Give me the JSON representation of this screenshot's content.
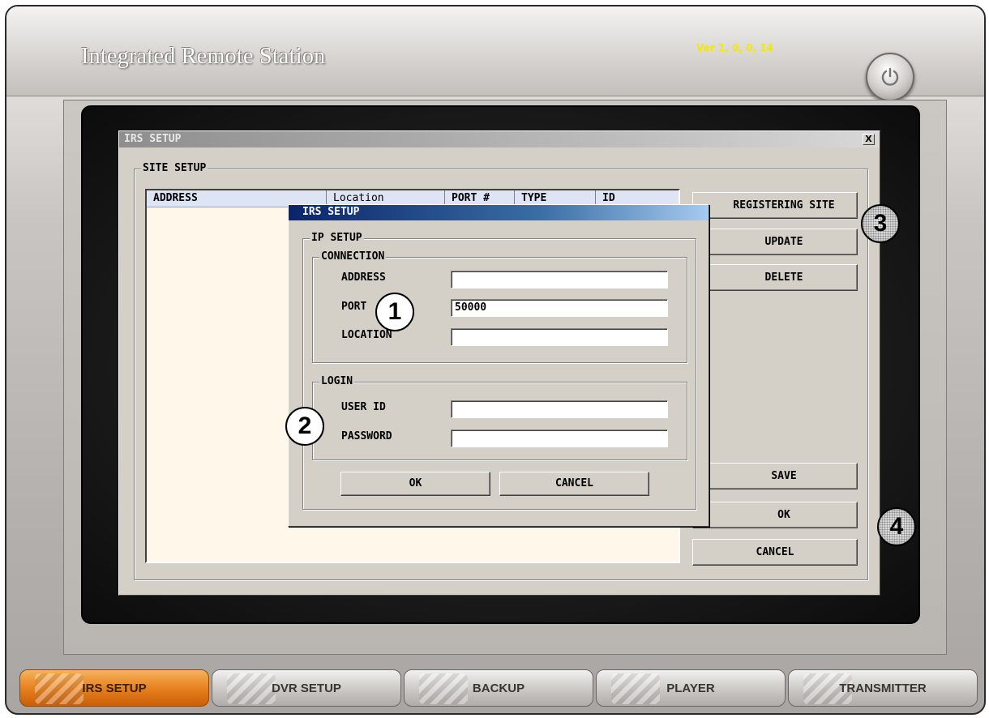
{
  "app": {
    "title": "Integrated Remote Station",
    "version": "Ver 1, 0, 0, 14",
    "power_icon": "power-icon",
    "colors": {
      "accent_tab": "#e8811f",
      "version_text": "#f3e800"
    }
  },
  "window": {
    "title": "IRS SETUP",
    "close_label": "X",
    "site_setup": {
      "group_label": "SITE SETUP",
      "columns": [
        "ADDRESS",
        "Location",
        "PORT #",
        "TYPE",
        "ID"
      ],
      "rows": []
    },
    "buttons": {
      "registering_site": "REGISTERING SITE",
      "update": "UPDATE",
      "delete": "DELETE",
      "save": "SAVE",
      "ok": "OK",
      "cancel": "CANCEL"
    }
  },
  "dialog": {
    "title": "IRS SETUP",
    "ip_setup_label": "IP SETUP",
    "connection": {
      "label": "CONNECTION",
      "address_label": "ADDRESS",
      "address_value": "",
      "port_label": "PORT",
      "port_value": "50000",
      "location_label": "LOCATION",
      "location_value": ""
    },
    "login": {
      "label": "LOGIN",
      "user_id_label": "USER ID",
      "user_id_value": "",
      "password_label": "PASSWORD",
      "password_value": ""
    },
    "ok_label": "OK",
    "cancel_label": "CANCEL"
  },
  "callouts": {
    "c1": "1",
    "c2": "2",
    "c3": "3",
    "c4": "4"
  },
  "tabs": [
    {
      "label": "IRS SETUP",
      "active": true
    },
    {
      "label": "DVR SETUP",
      "active": false
    },
    {
      "label": "BACKUP",
      "active": false
    },
    {
      "label": "PLAYER",
      "active": false
    },
    {
      "label": "TRANSMITTER",
      "active": false
    }
  ]
}
